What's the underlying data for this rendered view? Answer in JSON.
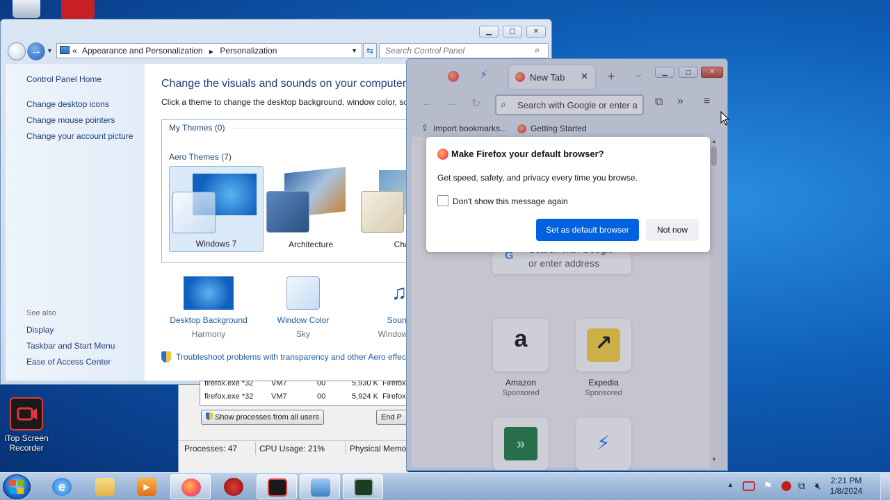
{
  "colors": {
    "accent": "#0061e0",
    "link": "#1a5aa6",
    "desktop": "#0f5fb8"
  },
  "desktop": {
    "icons": [
      {
        "name": "recycle-bin"
      },
      {
        "name": "itop-top"
      },
      {
        "label": "iTop Screen Recorder"
      }
    ]
  },
  "control_panel": {
    "breadcrumb": {
      "part1": "Appearance and Personalization",
      "part2": "Personalization",
      "sep": "«"
    },
    "search_placeholder": "Search Control Panel",
    "left": {
      "home": "Control Panel Home",
      "links": [
        "Change desktop icons",
        "Change mouse pointers",
        "Change your account picture"
      ],
      "see_also": "See also",
      "see_also_links": [
        "Display",
        "Taskbar and Start Menu",
        "Ease of Access Center"
      ]
    },
    "main": {
      "title": "Change the visuals and sounds on your computer",
      "subtitle": "Click a theme to change the desktop background, window color, so",
      "my_themes": "My Themes (0)",
      "aero_themes": "Aero Themes (7)",
      "themes": [
        "Windows 7",
        "Architecture",
        "Chara"
      ],
      "bottom": [
        {
          "title": "Desktop Background",
          "sub": "Harmony"
        },
        {
          "title": "Window Color",
          "sub": "Sky"
        },
        {
          "title": "Sound",
          "sub": "Windows D"
        }
      ],
      "troubleshoot": "Troubleshoot problems with transparency and other Aero effec"
    }
  },
  "task_manager": {
    "rows": [
      {
        "name": "firefox.exe *32",
        "user": "VM7",
        "cpu": "00",
        "mem": "5,924 K",
        "desc": "Firefox"
      }
    ],
    "partial_row": {
      "name": "firefox.exe *32",
      "user": "VM7",
      "cpu": "00",
      "mem": "5,930 K",
      "desc": "Firefox"
    },
    "show_all": "Show processes from all users",
    "end": "End P",
    "status": {
      "processes": "Processes: 47",
      "cpu": "CPU Usage: 21%",
      "memory": "Physical Memo"
    }
  },
  "firefox": {
    "tab_label": "New Tab",
    "url_placeholder": "Search with Google or enter a",
    "bookmarks": [
      "Import bookmarks...",
      "Getting Started"
    ],
    "page_search": {
      "line1": "Search with Google",
      "line2": "or enter address"
    },
    "tiles": [
      {
        "title": "Amazon",
        "sub": "Sponsored",
        "glyph": "a",
        "bg": "#ffffff"
      },
      {
        "title": "Expedia",
        "sub": "Sponsored",
        "glyph": "↗",
        "bg": "#fcd535"
      }
    ],
    "dialog": {
      "title": "Make Firefox your default browser?",
      "body": "Get speed, safety, and privacy every time you browse.",
      "checkbox": "Don't show this message again",
      "primary": "Set as default browser",
      "secondary": "Not now"
    }
  },
  "taskbar": {
    "clock_time": "2:21 PM",
    "clock_date": "1/8/2024"
  }
}
